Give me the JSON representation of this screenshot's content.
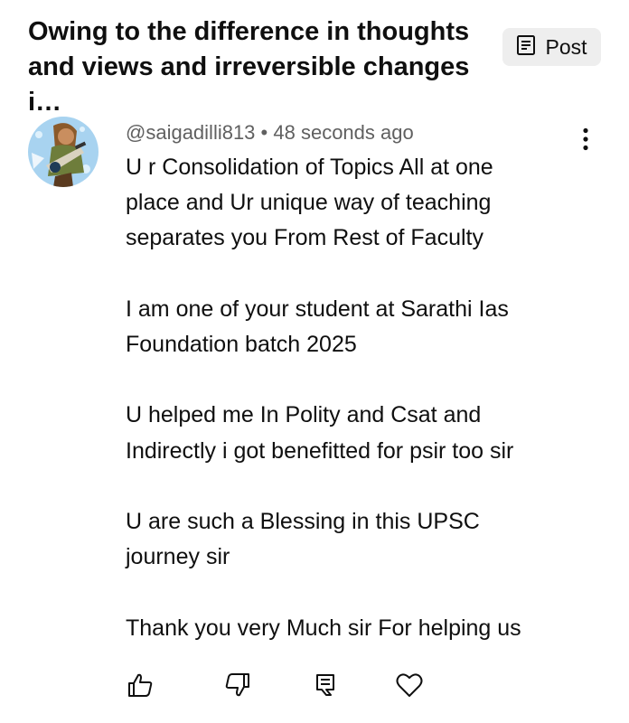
{
  "video": {
    "title": "Owing to the difference in thoughts\nand views and irreversible changes i…"
  },
  "post_chip": {
    "label": "Post",
    "icon": "post-icon"
  },
  "comment": {
    "author": "@saigadilli813",
    "separator": "•",
    "timestamp": "48 seconds ago",
    "text": "U r Consolidation of Topics All at one\nplace and Ur unique way of teaching\nseparates you From Rest of Faculty\n\nI am one of your student at Sarathi Ias\nFoundation batch 2025\n\nU helped me In Polity and Csat  and\nIndirectly i got benefitted for psir too sir\n\nU are such a Blessing in this UPSC\njourney sir\n\nThank you very Much sir For helping us"
  },
  "icons": {
    "menu": "more-vertical-icon",
    "like": "thumbs-up-icon",
    "dislike": "thumbs-down-icon",
    "reply": "reply-icon",
    "heart": "heart-icon"
  },
  "colors": {
    "text": "#0f0f0f",
    "secondary": "#606060",
    "chip_bg": "#eeeeee"
  }
}
